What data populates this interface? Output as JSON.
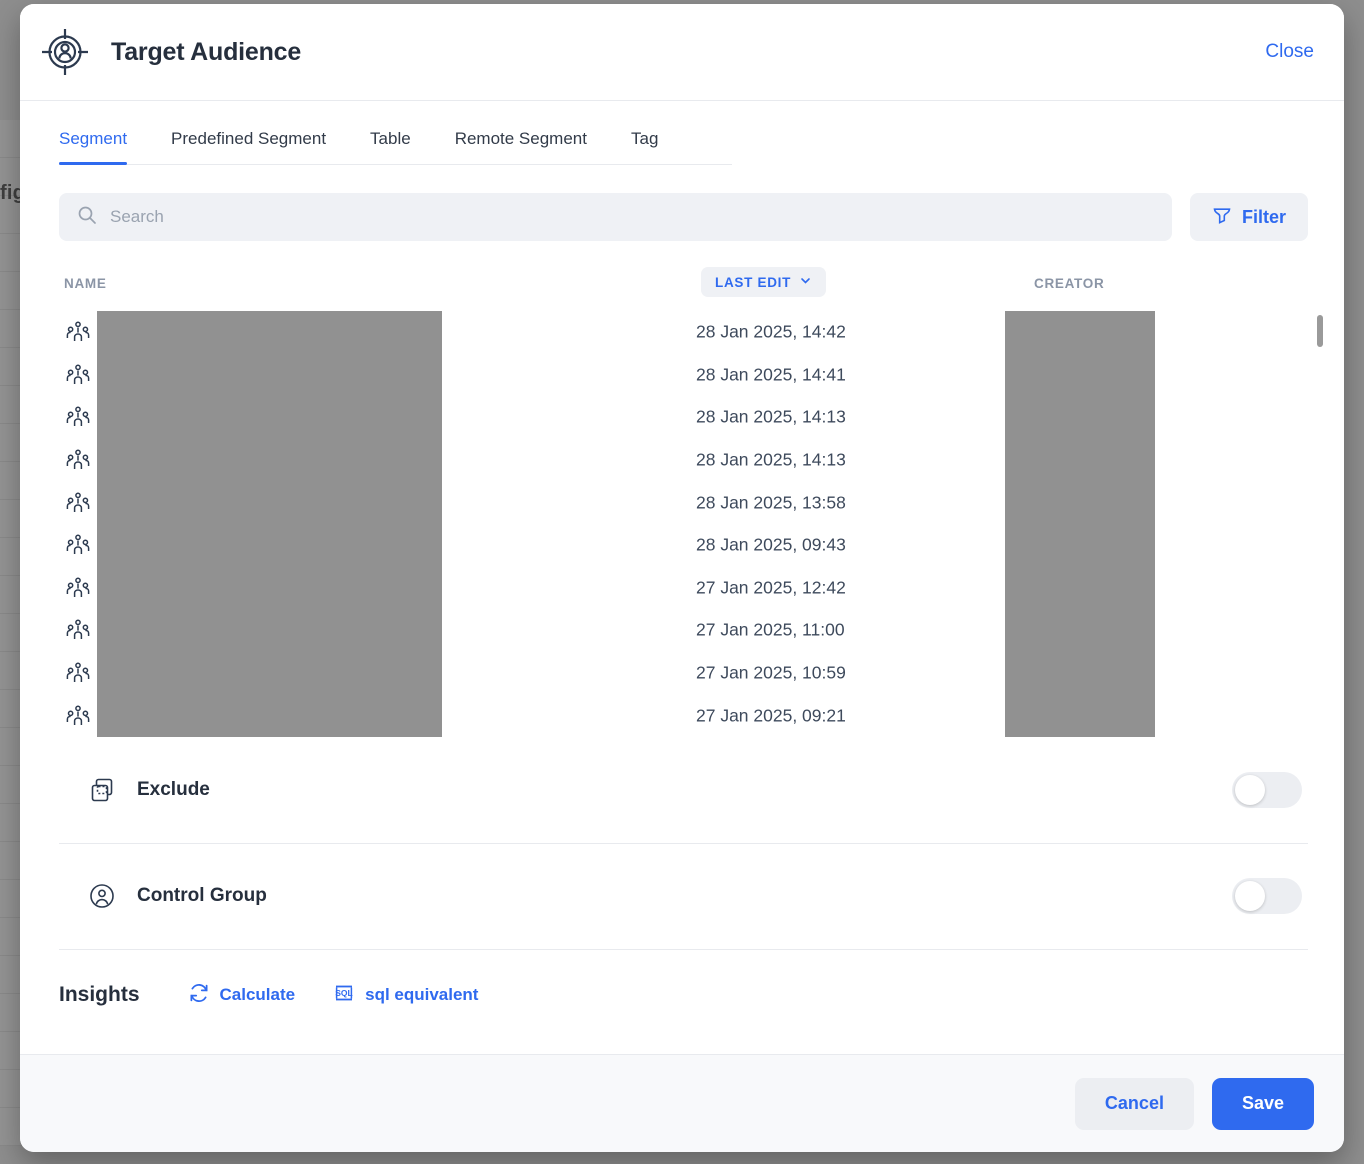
{
  "background": {
    "partial_text": "fig"
  },
  "modal": {
    "title": "Target Audience",
    "title_icon": "target-person-icon",
    "close_label": "Close",
    "tabs": [
      {
        "label": "Segment",
        "active": true
      },
      {
        "label": "Predefined Segment",
        "active": false
      },
      {
        "label": "Table",
        "active": false
      },
      {
        "label": "Remote Segment",
        "active": false
      },
      {
        "label": "Tag",
        "active": false
      }
    ],
    "search": {
      "placeholder": "Search",
      "value": "",
      "icon": "search-icon"
    },
    "filter": {
      "label": "Filter",
      "icon": "funnel-icon"
    },
    "table": {
      "columns": {
        "name": "NAME",
        "last_edit": "LAST EDIT",
        "creator": "CREATOR"
      },
      "sort_column": "LAST EDIT",
      "sort_icon": "chevron-down-icon",
      "row_icon": "segment-people-icon",
      "rows": [
        {
          "name": "",
          "last_edit": "28 Jan 2025, 14:42",
          "creator": ""
        },
        {
          "name": "",
          "last_edit": "28 Jan 2025, 14:41",
          "creator": ""
        },
        {
          "name": "",
          "last_edit": "28 Jan 2025, 14:13",
          "creator": ""
        },
        {
          "name": "",
          "last_edit": "28 Jan 2025, 14:13",
          "creator": ""
        },
        {
          "name": "",
          "last_edit": "28 Jan 2025, 13:58",
          "creator": ""
        },
        {
          "name": "",
          "last_edit": "28 Jan 2025, 09:43",
          "creator": ""
        },
        {
          "name": "",
          "last_edit": "27 Jan 2025, 12:42",
          "creator": ""
        },
        {
          "name": "",
          "last_edit": "27 Jan 2025, 11:00",
          "creator": ""
        },
        {
          "name": "",
          "last_edit": "27 Jan 2025, 10:59",
          "creator": ""
        },
        {
          "name": "",
          "last_edit": "27 Jan 2025, 09:21",
          "creator": ""
        }
      ]
    },
    "options": [
      {
        "label": "Exclude",
        "icon": "exclude-shapes-icon",
        "enabled": false
      },
      {
        "label": "Control Group",
        "icon": "user-circle-icon",
        "enabled": false
      }
    ],
    "insights": {
      "label": "Insights",
      "calculate_label": "Calculate",
      "calculate_icon": "refresh-icon",
      "sql_label": "sql equivalent",
      "sql_icon": "sql-icon"
    },
    "footer": {
      "cancel_label": "Cancel",
      "save_label": "Save"
    }
  },
  "colors": {
    "accent": "#2f6aef",
    "text_dark": "#262f3d",
    "text_muted": "#8b95a6",
    "surface": "#eff1f5",
    "redacted": "#919191",
    "backdrop": "#8e8e8e"
  }
}
